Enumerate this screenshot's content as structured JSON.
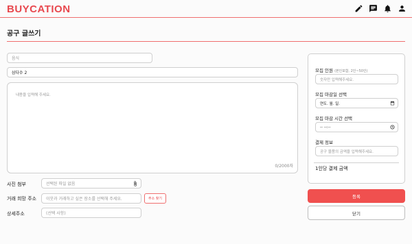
{
  "header": {
    "logo": "BUYCATION",
    "icons": [
      "pencil-icon",
      "chat-icon",
      "bell-icon",
      "user-icon"
    ]
  },
  "page": {
    "title": "공구 글쓰기"
  },
  "form": {
    "category_placeholder": "음식",
    "title_value": "삼다수 2",
    "content_placeholder": "내용을 입력해 주세요.",
    "char_count": "0/2000자",
    "photo_label": "사진 첨부",
    "photo_placeholder": "선택된 파일 없음",
    "trade_address_label": "거래 희망 주소",
    "trade_address_placeholder": "이웃과 거래하고 싶은 장소를 선택해 주세요.",
    "address_search_button": "주소 찾기",
    "detail_address_label": "상세주소",
    "detail_address_placeholder": "(선택 사항)"
  },
  "side": {
    "recruit_label": "모집 인원",
    "recruit_hint": "(본인포함, 2인~50인)",
    "recruit_placeholder": "숫자만 입력해주세요.",
    "deadline_date_label": "모집 마감일 선택",
    "deadline_date_value": "연도. 월. 일.",
    "deadline_time_label": "모집 마감 시간 선택",
    "deadline_time_value": "-- --:--",
    "payment_label": "결제 정보",
    "payment_placeholder": "공구 물품의 금액을 입력해주세요.",
    "per_person_label": "1인당 결제 금액"
  },
  "actions": {
    "submit": "등록",
    "close": "닫기"
  },
  "colors": {
    "accent": "#e8484e",
    "submit_bg": "#f0504f"
  }
}
